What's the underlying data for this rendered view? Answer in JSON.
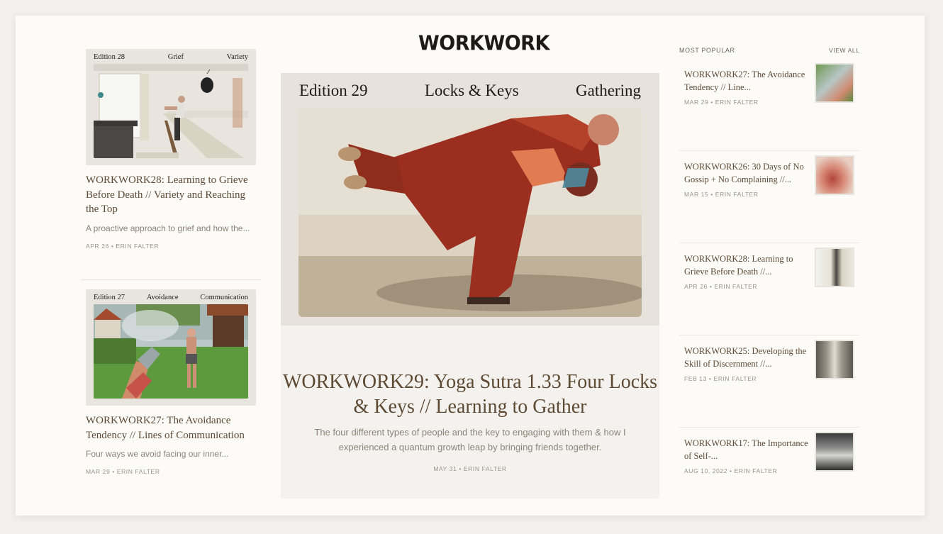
{
  "brand": {
    "logo": "WORKWORK"
  },
  "left_articles": [
    {
      "edition": "Edition 28",
      "theme": "Grief",
      "tag": "Variety",
      "title": "WORKWORK28: Learning to Grieve Before Death // Variety and Reaching the Top",
      "excerpt": "A proactive approach to grief and how the...",
      "meta": "APR 26 • ERIN FALTER"
    },
    {
      "edition": "Edition 27",
      "theme": "Avoidance",
      "tag": "Communication",
      "title": "WORKWORK27: The Avoidance Tendency // Lines of Communication",
      "excerpt": "Four ways we avoid facing our inner...",
      "meta": "MAR 29 • ERIN FALTER"
    }
  ],
  "hero": {
    "edition": "Edition 29",
    "theme": "Locks & Keys",
    "tag": "Gathering",
    "title": "WORKWORK29: Yoga Sutra 1.33 Four Locks & Keys // Learning to Gather",
    "excerpt": "The four different types of people and the key to engaging with them & how I experienced a quantum growth leap by bringing friends together.",
    "meta": "MAY 31 • ERIN FALTER"
  },
  "most_popular": {
    "heading": "MOST POPULAR",
    "view_all": "VIEW ALL",
    "items": [
      {
        "title": "WORKWORK27: The Avoidance Tendency // Line...",
        "meta": "MAR 29 • ERIN FALTER"
      },
      {
        "title": "WORKWORK26: 30 Days of No Gossip + No Complaining //...",
        "meta": "MAR 15 • ERIN FALTER"
      },
      {
        "title": "WORKWORK28: Learning to Grieve Before Death //...",
        "meta": "APR 26 • ERIN FALTER"
      },
      {
        "title": "WORKWORK25: Developing the Skill of Discernment //...",
        "meta": "FEB 13 • ERIN FALTER"
      },
      {
        "title": "WORKWORK17: The Importance of Self-...",
        "meta": "AUG 10, 2022 • ERIN FALTER"
      }
    ]
  }
}
